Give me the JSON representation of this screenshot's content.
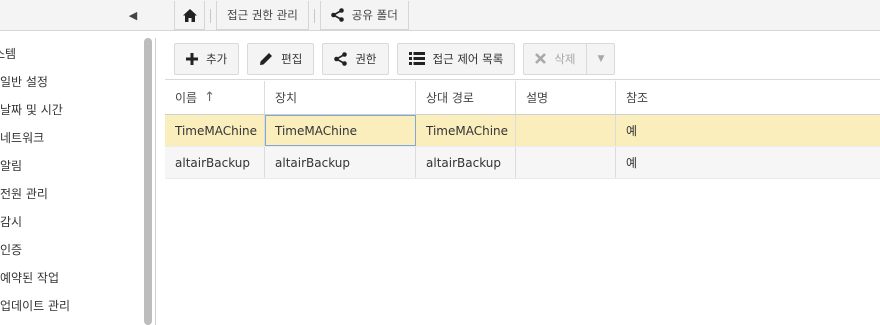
{
  "topbar": {
    "collapse_icon": "◀",
    "home_icon": "home-icon",
    "breadcrumbs": [
      {
        "label": "접근 권한 관리"
      },
      {
        "label": "공유 폴더",
        "icon": "share-icon"
      }
    ]
  },
  "sidebar": {
    "items": [
      {
        "label": "스템"
      },
      {
        "label": "일반 설정"
      },
      {
        "label": "날짜 및 시간"
      },
      {
        "label": "네트워크"
      },
      {
        "label": "알림"
      },
      {
        "label": "전원 관리"
      },
      {
        "label": "감시"
      },
      {
        "label": "인증"
      },
      {
        "label": "예약된 작업"
      },
      {
        "label": "업데이트 관리"
      }
    ]
  },
  "toolbar": {
    "add_label": "추가",
    "edit_label": "편집",
    "permission_label": "권한",
    "acl_label": "접근 제어 목록",
    "delete_label": "삭제"
  },
  "grid": {
    "columns": [
      "이름",
      "장치",
      "상대 경로",
      "설명",
      "참조"
    ],
    "sort_icon": "↑",
    "rows": [
      [
        "TimeMAChine",
        "TimeMAChine",
        "TimeMAChine",
        "",
        "예"
      ],
      [
        "altairBackup",
        "altairBackup",
        "altairBackup",
        "",
        "예"
      ]
    ]
  },
  "colors": {
    "selected_row": "#fbeebd",
    "focus_outline": "#7fa8d6"
  }
}
